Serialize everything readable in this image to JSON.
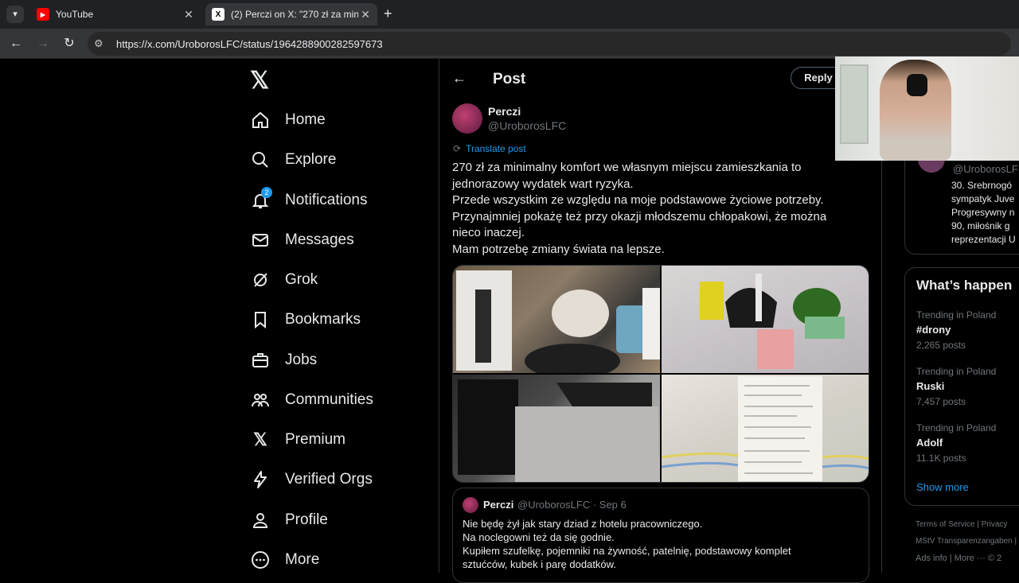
{
  "browser": {
    "tabs": [
      {
        "title": "YouTube",
        "favicon": "youtube-icon",
        "active": false
      },
      {
        "title": "(2) Perczi on X: \"270 zł za minim",
        "favicon": "x-icon",
        "active": true
      }
    ],
    "url": "https://x.com/UroborosLFC/status/1964288900282597673"
  },
  "sidebar": {
    "items": [
      {
        "label": "Home",
        "icon": "home-icon"
      },
      {
        "label": "Explore",
        "icon": "search-icon"
      },
      {
        "label": "Notifications",
        "icon": "bell-icon",
        "badge": "2"
      },
      {
        "label": "Messages",
        "icon": "mail-icon"
      },
      {
        "label": "Grok",
        "icon": "grok-icon"
      },
      {
        "label": "Bookmarks",
        "icon": "bookmark-icon"
      },
      {
        "label": "Jobs",
        "icon": "briefcase-icon"
      },
      {
        "label": "Communities",
        "icon": "people-icon"
      },
      {
        "label": "Premium",
        "icon": "x-icon"
      },
      {
        "label": "Verified Orgs",
        "icon": "lightning-icon"
      },
      {
        "label": "Profile",
        "icon": "person-icon"
      },
      {
        "label": "More",
        "icon": "more-icon"
      }
    ]
  },
  "main": {
    "header_title": "Post",
    "reply_label": "Reply",
    "post": {
      "author_name": "Perczi",
      "author_handle": "@UroborosLFC",
      "translate_label": "Translate post",
      "text": "270 zł za minimalny komfort we własnym miejscu zamieszkania to\njednorazowy wydatek wart ryzyka.\nPrzede wszystkim ze względu na moje podstawowe życiowe potrzeby.\nPrzynajmniej pokażę też przy okazji młodszemu chłopakowi, że można\nnieco inaczej.\nMam potrzebę zmiany świata na lepsze."
    },
    "quote": {
      "author_name": "Perczi",
      "meta": "@UroborosLFC · Sep 6",
      "text": "Nie będę żył jak stary dziad z hotelu pracowniczego.\nNa noclegowni też da się godnie.\nKupiłem szufelkę, pojemniki na żywność, patelnię, podstawowy komplet\nsztućców, kubek i parę dodatków."
    }
  },
  "right": {
    "bio_handle": "@UroborosLF",
    "bio_text": "30. Srebrnogó\nsympatyk Juve\nProgresywny n\n90, miłośnik g\nreprezentacji U",
    "trends_title": "What’s happen",
    "trends": [
      {
        "context": "Trending in Poland",
        "name": "#drony",
        "count": "2,265 posts"
      },
      {
        "context": "Trending in Poland",
        "name": "Ruski",
        "count": "7,457 posts"
      },
      {
        "context": "Trending in Poland",
        "name": "Adolf",
        "count": "11.1K posts"
      }
    ],
    "show_more": "Show more",
    "footer_row1": "Terms of Service  |  Privacy",
    "footer_row2": "MStV Transparenzangaben  |",
    "footer_row3": "Ads info  |  More ···  © 2"
  }
}
